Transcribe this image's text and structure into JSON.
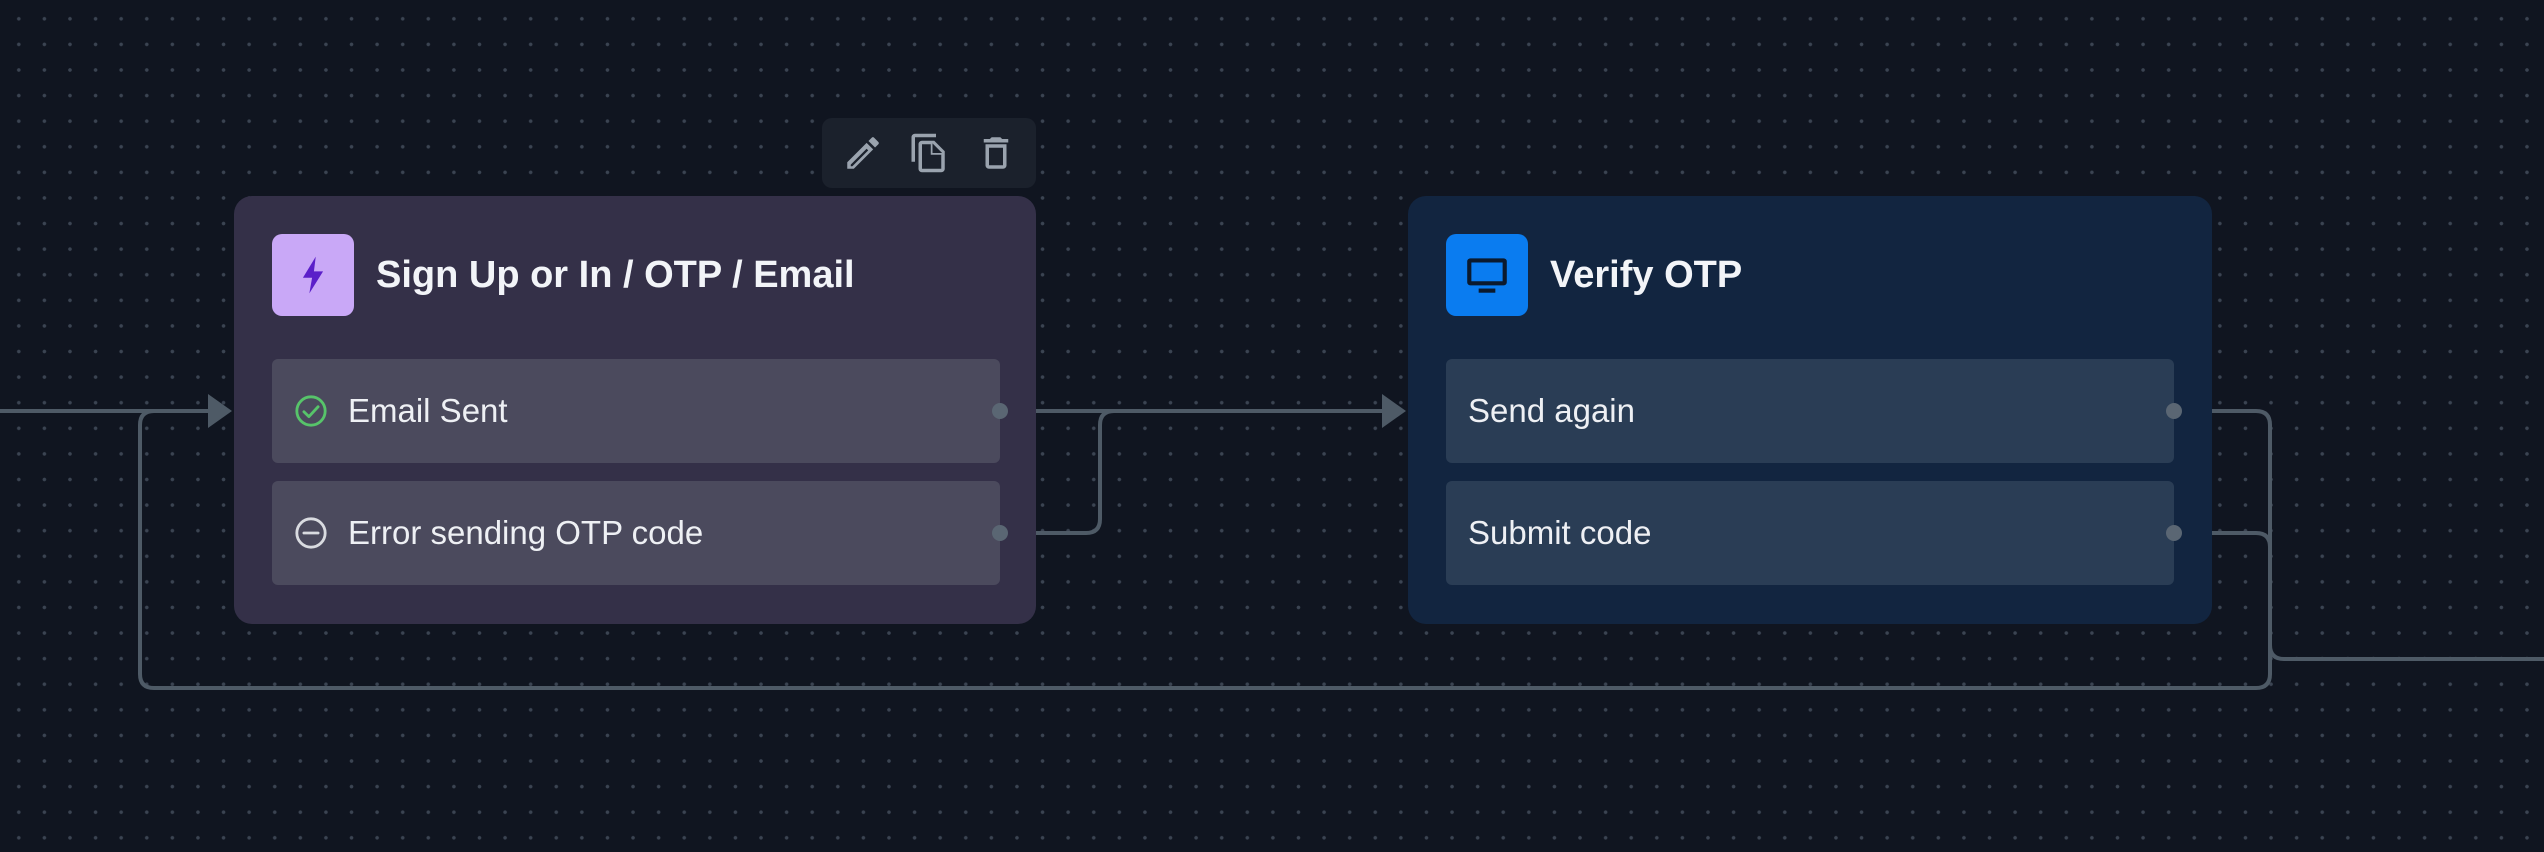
{
  "toolbar": {
    "actions": [
      {
        "name": "edit",
        "icon": "pencil-icon"
      },
      {
        "name": "duplicate",
        "icon": "copy-icon"
      },
      {
        "name": "delete",
        "icon": "trash-icon"
      }
    ]
  },
  "nodes": {
    "signup": {
      "title": "Sign Up or In / OTP / Email",
      "icon": "lightning-icon",
      "icon_bg": "#c9a8f7",
      "icon_color": "#5b1fc9",
      "ports": [
        {
          "label": "Email Sent",
          "icon": "check-circle-icon",
          "icon_color": "#57c46a"
        },
        {
          "label": "Error sending OTP code",
          "icon": "minus-circle-icon",
          "icon_color": "#d9dbe0"
        }
      ]
    },
    "verify": {
      "title": "Verify OTP",
      "icon": "monitor-icon",
      "icon_bg": "#0a7cf0",
      "icon_color": "#0b1a2e",
      "ports": [
        {
          "label": "Send again"
        },
        {
          "label": "Submit code"
        }
      ]
    }
  },
  "colors": {
    "canvas_bg": "#101520",
    "edge": "#4e5a66",
    "signup_node_bg": "#343048",
    "verify_node_bg": "#122540"
  }
}
